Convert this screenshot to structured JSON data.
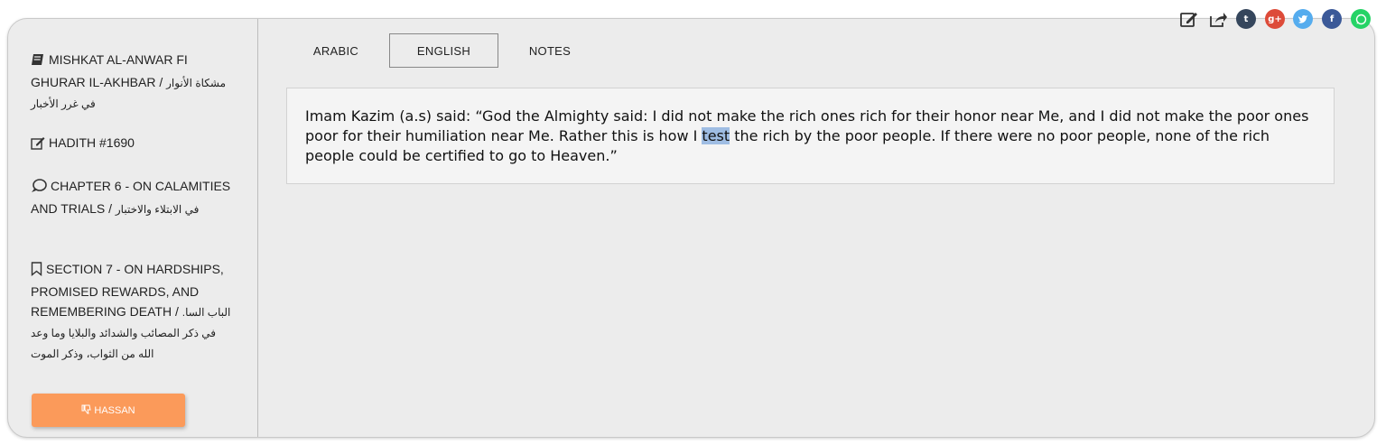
{
  "sidebar": {
    "book": {
      "en": "MISHKAT AL-ANWAR FI GHURAR IL-AKHBAR /",
      "ar": "مشكاة الأنوار في غرر الأخبار"
    },
    "hadith": {
      "en": "HADITH #1690"
    },
    "chapter": {
      "en": "CHAPTER 6 - ON CALAMITIES AND TRIALS /",
      "ar": "في الابتلاء والاختبار"
    },
    "section": {
      "en": "SECTION 7 - ON HARDSHIPS, PROMISED REWARDS, AND REMEMBERING DEATH /",
      "ar": "الباب السا. في ذكر المصائب والشدائد والبلايا وما وعد الله من الثواب، وذكر الموت"
    },
    "narrator_button": "HASSAN"
  },
  "tabs": [
    {
      "label": "ARABIC",
      "active": false
    },
    {
      "label": "ENGLISH",
      "active": true
    },
    {
      "label": "NOTES",
      "active": false
    }
  ],
  "hadith_text": {
    "before": "Imam Kazim (a.s) said: “God the Almighty said: I did not make the rich ones rich for their honor near Me, and I did not make the poor ones poor for their humiliation near Me. Rather this is how I ",
    "highlighted": "test",
    "after": " the rich by the poor people. If there were no poor people, none of the rich people could be certified to go to Heaven.”"
  },
  "share_icons": [
    {
      "name": "edit-icon",
      "glyph": "✎"
    },
    {
      "name": "share-icon",
      "glyph": "↱"
    },
    {
      "name": "tumblr-icon",
      "glyph": "t",
      "color": "#35465c"
    },
    {
      "name": "google-plus-icon",
      "glyph": "g+",
      "color": "#dd4b39"
    },
    {
      "name": "twitter-icon",
      "glyph": "✦",
      "color": "#55acee"
    },
    {
      "name": "facebook-icon",
      "glyph": "f",
      "color": "#3b5998"
    },
    {
      "name": "whatsapp-icon",
      "glyph": "✆",
      "color": "#25d366"
    }
  ],
  "colors": {
    "accent": "#fb9a5a",
    "highlight": "#9fbde3"
  }
}
